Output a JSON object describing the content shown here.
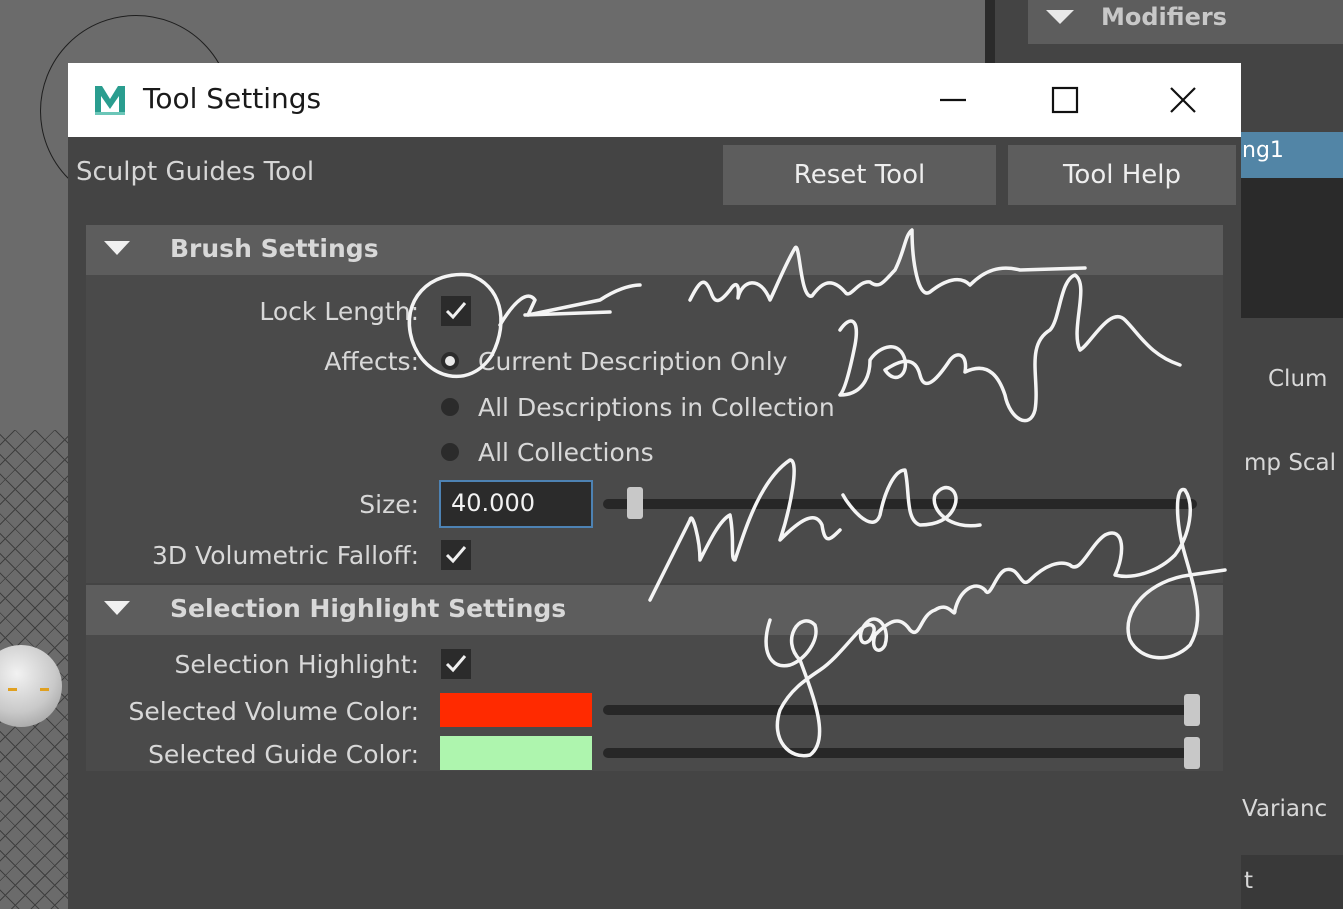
{
  "right_panel": {
    "header": "Modifiers",
    "selected_item": "ng1",
    "labels": [
      "Clum",
      "mp Scal",
      "Varianc",
      "t"
    ]
  },
  "dialog": {
    "title": "Tool Settings",
    "app_icon_letter": "M",
    "tool_name": "Sculpt Guides Tool",
    "reset_label": "Reset Tool",
    "help_label": "Tool Help"
  },
  "brush": {
    "section_title": "Brush Settings",
    "lock_length_label": "Lock Length:",
    "lock_length_checked": true,
    "affects_label": "Affects:",
    "affects_options": [
      "Current Description Only",
      "All Descriptions in Collection",
      "All Collections"
    ],
    "affects_selected": "Current Description Only",
    "size_label": "Size:",
    "size_value": "40.000",
    "volumetric_label": "3D Volumetric Falloff:",
    "volumetric_checked": true
  },
  "selection": {
    "section_title": "Selection Highlight Settings",
    "highlight_label": "Selection Highlight:",
    "highlight_checked": true,
    "volume_color_label": "Selected Volume Color:",
    "volume_color": "#ff2a00",
    "guide_color_label": "Selected Guide Color:",
    "guide_color": "#aef5ae"
  },
  "colors": {
    "accent_blue": "#4d82b3",
    "panel_bg": "#444444",
    "section_bg": "#5d5d5d"
  }
}
